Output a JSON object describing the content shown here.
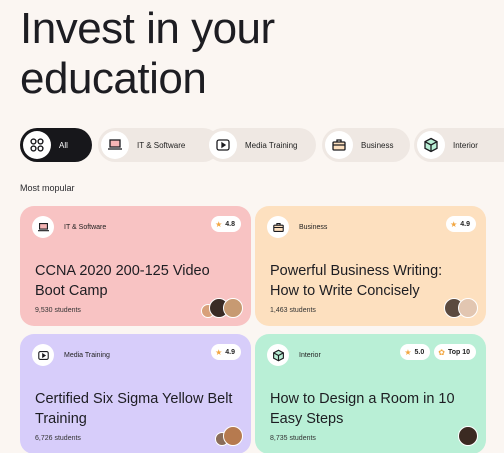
{
  "hero": {
    "line1": "Invest in your",
    "line2": "education"
  },
  "categories": [
    {
      "label": "All",
      "icon": "grid-icon",
      "active": true
    },
    {
      "label": "IT & Software",
      "icon": "laptop-icon"
    },
    {
      "label": "Media Training",
      "icon": "video-icon"
    },
    {
      "label": "Business",
      "icon": "briefcase-icon"
    },
    {
      "label": "Interior",
      "icon": "box-icon"
    }
  ],
  "section": {
    "label": "Most mopular"
  },
  "courses": [
    {
      "category": "IT & Software",
      "icon": "laptop-icon",
      "rating": "4.8",
      "title": "CCNA 2020 200-125 Video Boot Camp",
      "students": "9,530 students",
      "color": "#f8c3c3"
    },
    {
      "category": "Business",
      "icon": "briefcase-icon",
      "rating": "4.9",
      "title": "Powerful Business Writing: How to Write Concisely",
      "students": "1,463 students",
      "color": "#fde0bf"
    },
    {
      "category": "Media Training",
      "icon": "video-icon",
      "rating": "4.9",
      "title": "Certified Six Sigma Yellow Belt Training",
      "students": "6,726 students",
      "color": "#d7cdfa"
    },
    {
      "category": "Interior",
      "icon": "box-icon",
      "rating": "5.0",
      "tag": "Top 10",
      "title": "How to Design a Room in 10 Easy Steps",
      "students": "8,735 students",
      "color": "#b9efd6"
    }
  ]
}
